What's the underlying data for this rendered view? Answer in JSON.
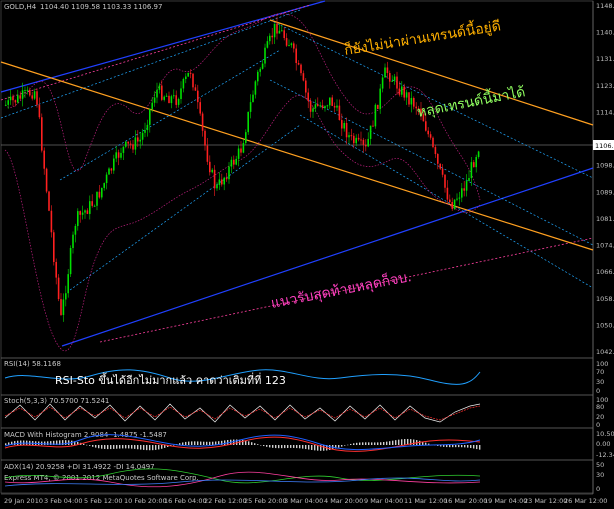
{
  "main_chart": {
    "symbol_label": "GOLD,H4",
    "ohlc_text": "1104.40 1109.58 1103.33 1106.97",
    "price_ticks": [
      "1148.60",
      "1140.05",
      "1131.50",
      "1123.20",
      "1114.65",
      "1106.97",
      "1098.65",
      "1089.85",
      "1081.75",
      "1074.00",
      "1066.55",
      "1058.00",
      "1050.70",
      "1042.35"
    ],
    "current_price": "1106.97",
    "annotations": {
      "orange": "ก็ยังไม่น่าผ่านเทรนด์นี้อยู่ดี",
      "green": "หลุดเทรนด์นี้มาได้",
      "pink": "แนวรับสุดท้ายหลุดก็จบ."
    },
    "colors": {
      "bull_candle": "#00e000",
      "bear_candle": "#ff2020",
      "orange_trend": "#ffa020",
      "blue_channel": "#2040ff",
      "cyan_dotted": "#20a8ff",
      "pink_dotted": "#ff40a0",
      "annotation_orange": "#ffb000",
      "annotation_green": "#90ff60",
      "annotation_pink": "#ff40c0"
    }
  },
  "indicators": [
    {
      "label": "RSI(14) 58.1168",
      "ticks": [
        "100",
        "70",
        "30",
        "0"
      ]
    },
    {
      "label": "Stoch(5,3,3) 70.5700 71.5241",
      "ticks": [
        "100",
        "80",
        "20",
        "0"
      ]
    },
    {
      "label": "MACD With Histogram 2.9084 -1.4875 -1.5487",
      "ticks": [
        "10.5059",
        "0.00",
        "-12.344"
      ]
    },
    {
      "label": "ADX(14) 20.9258 +DI 31.4922 -DI 14.0497",
      "ticks": [
        "50",
        "30",
        "0"
      ]
    }
  ],
  "indicator_overlay_text": "RSI-Sto ขึ้นได้อีกไม่มากแล้ว คาดว่าเติมที่ที่ 123",
  "footer_text": "Express MT4, © 2001-2012 MetaQuotes Software Corp.",
  "time_axis": [
    "29 Jan 2010",
    "3 Feb 04:00",
    "5 Feb 12:00",
    "10 Feb 20:00",
    "16 Feb 04:00",
    "22 Feb 12:00",
    "25 Feb 20:00",
    "3 Mar 04:00",
    "4 Mar 20:00",
    "9 Mar 04:00",
    "11 Mar 12:00",
    "16 Mar 20:00",
    "19 Mar 04:00",
    "23 Mar 12:00",
    "26 Mar 12:00"
  ]
}
